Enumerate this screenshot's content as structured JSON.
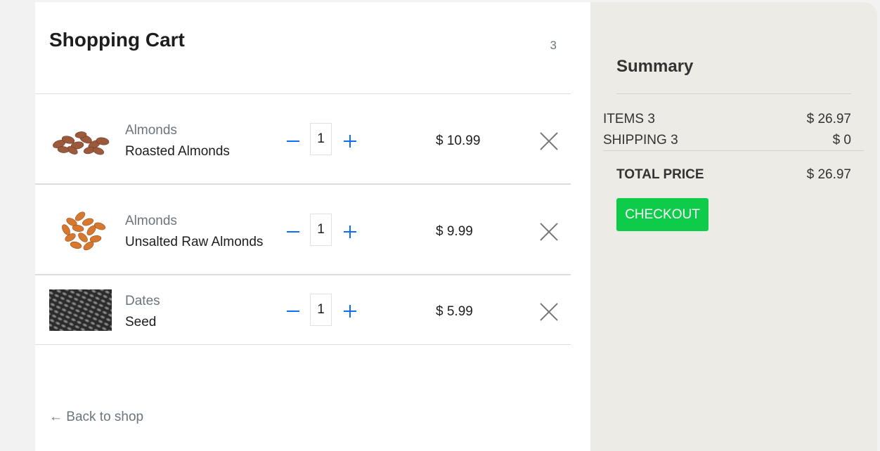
{
  "cart": {
    "title": "Shopping Cart",
    "item_count": "3",
    "back_link": "← Back to shop",
    "items": [
      {
        "category": "Almonds",
        "name": "Roasted Almonds",
        "quantity": "1",
        "price": "$ 10.99",
        "image": "roasted-almonds-photo"
      },
      {
        "category": "Almonds",
        "name": "Unsalted Raw Almonds",
        "quantity": "1",
        "price": "$ 9.99",
        "image": "raw-almonds-photo"
      },
      {
        "category": "Dates",
        "name": "Seed",
        "quantity": "1",
        "price": "$ 5.99",
        "image": "seeds-photo"
      }
    ]
  },
  "summary": {
    "title": "Summary",
    "items_label": "ITEMS 3",
    "items_value": "$ 26.97",
    "shipping_label": "SHIPPING 3",
    "shipping_value": "$ 0",
    "total_label": "TOTAL PRICE",
    "total_value": "$ 26.97",
    "checkout_label": "CHECKOUT"
  },
  "colors": {
    "accent_blue": "#0d6efd",
    "checkout_green": "#0fcb4a",
    "summary_bg": "#ecebe6",
    "muted_text": "#6c757d"
  },
  "icons": {
    "decrease": "minus-icon",
    "increase": "plus-icon",
    "remove": "close-icon"
  }
}
